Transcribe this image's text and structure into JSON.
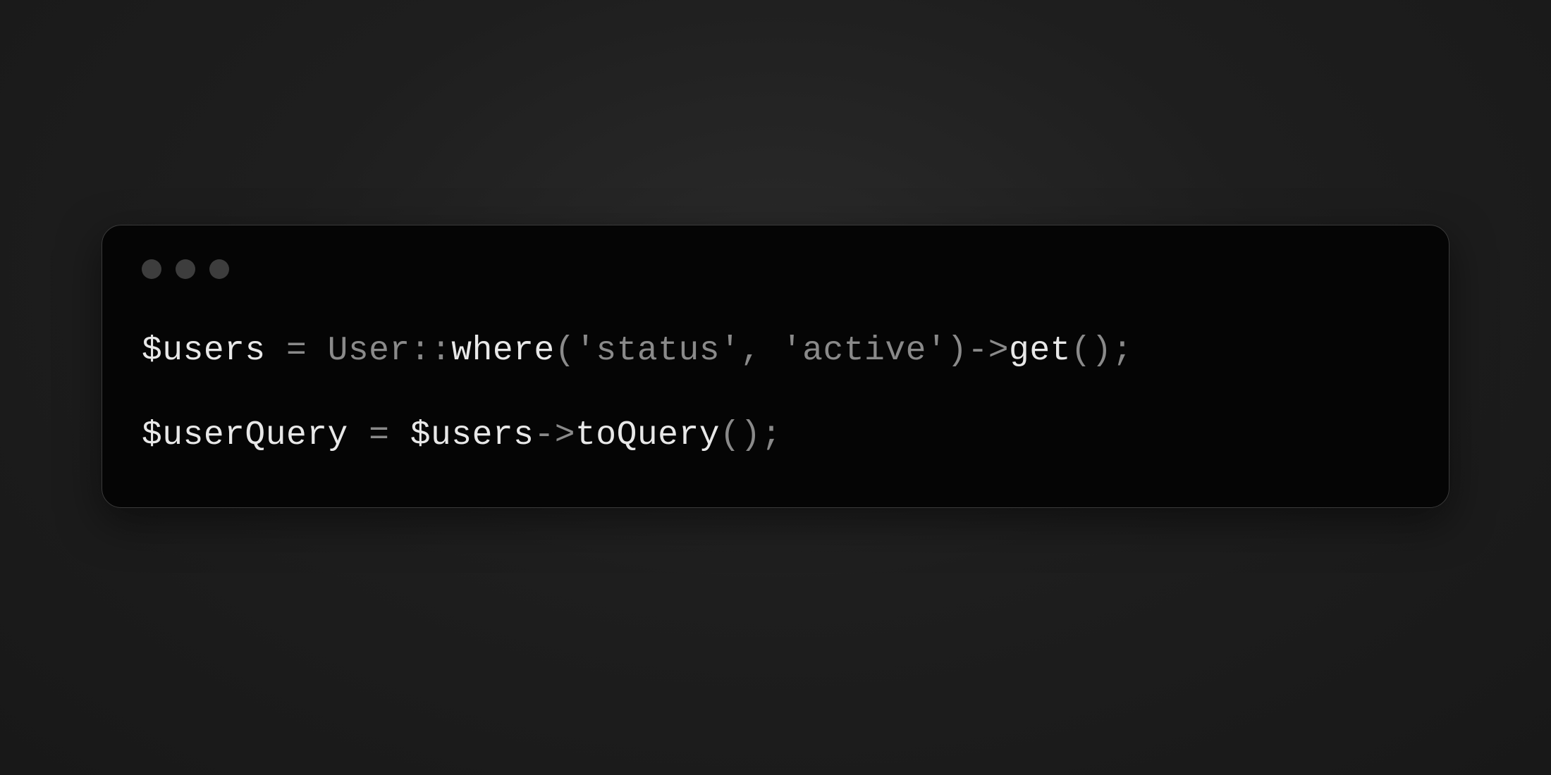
{
  "code": {
    "line1": {
      "t01": "$users",
      "t02": " = ",
      "t03": "User",
      "t04": "::",
      "t05": "where",
      "t06": "(",
      "t07": "'status'",
      "t08": ", ",
      "t09": "'active'",
      "t10": ")",
      "t11": "->",
      "t12": "get",
      "t13": "();"
    },
    "blank": " ",
    "line2": {
      "t01": "$userQuery",
      "t02": " = ",
      "t03": "$users",
      "t04": "->",
      "t05": "toQuery",
      "t06": "();"
    }
  }
}
